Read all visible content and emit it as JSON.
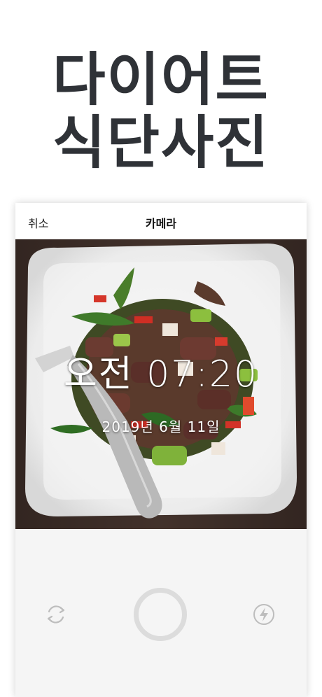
{
  "headline": {
    "line1": "다이어트",
    "line2": "식단사진"
  },
  "navbar": {
    "cancel_label": "취소",
    "title": "카메라"
  },
  "preview": {
    "time_text": "오전 07:20",
    "date_text": "2019년 6월 11일"
  },
  "controls": {
    "switch_camera_icon": "refresh-icon",
    "shutter_icon": "shutter-ring",
    "flash_icon": "flash-icon"
  },
  "colors": {
    "headline": "#2f3237",
    "background": "#ffffff",
    "controls_bg": "#f5f5f5",
    "icon_gray": "#bdbdbd"
  }
}
